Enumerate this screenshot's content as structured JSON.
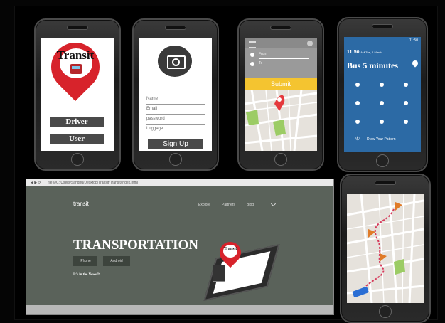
{
  "phone1": {
    "logo_text": "Transit",
    "driver_label": "Driver",
    "user_label": "User",
    "pin_color": "#d7232b"
  },
  "phone2": {
    "fields": [
      "Name",
      "Email",
      "password",
      "Luggage"
    ],
    "signup_label": "Sign Up",
    "camera_icon": "camera-icon"
  },
  "phone3": {
    "from_placeholder": "From",
    "to_placeholder": "To",
    "submit_label": "Submit",
    "submit_color": "#f4c430"
  },
  "phone4": {
    "status_time": "11:50",
    "date_line_time": "11:50",
    "date_line_suffix": "AM Tue, 1 March",
    "headline": "Bus 5 minutes",
    "pattern_label": "Draw Your Pattern",
    "bg_color": "#2c6aa5"
  },
  "website": {
    "url": "file:///C:/Users/Sandhu/Desktop/Transit/Transit/index.html",
    "brand": "transit",
    "nav": [
      "Explore",
      "Partners",
      "Blog"
    ],
    "hero_title": "TRANSPORTATION",
    "btn_iphone": "iPhone",
    "btn_android": "Android",
    "tagline": "It's in the News™",
    "tablet_logo": "Transit"
  }
}
